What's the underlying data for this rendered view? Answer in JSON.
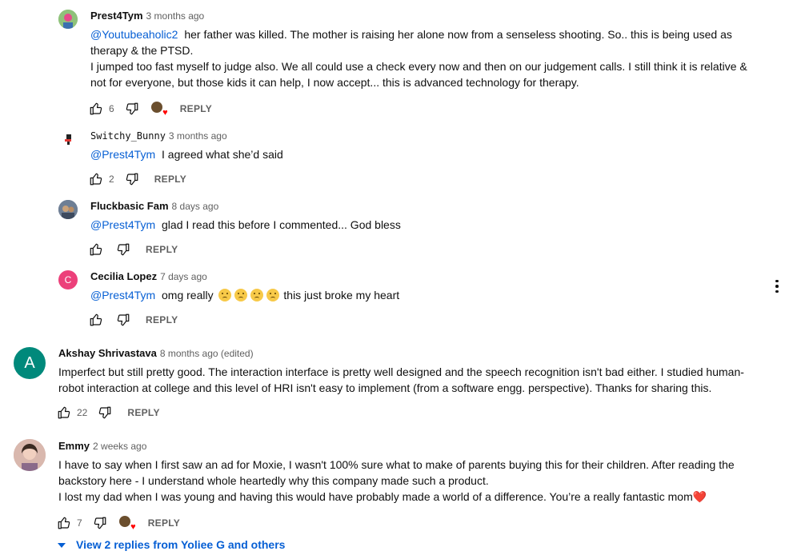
{
  "comments": [
    {
      "author": "Prest4Tym",
      "time": "3 months ago",
      "mention": "@Youtubeaholic2",
      "text_first": "her father was killed. The mother is raising her alone now from a senseless shooting. So.. this is being used as",
      "text_lines": [
        "therapy & the PTSD.",
        "I jumped too fast myself to judge also. We all could use a check every now and then on our judgement calls. I still think it is relative &",
        "not for everyone, but those kids it can help, I now accept... this is advanced technology for therapy."
      ],
      "likes": "6",
      "reply_label": "REPLY",
      "avatar_color": "#7bb36a"
    },
    {
      "author": "Switchy_Bunny",
      "time": "3 months ago",
      "mention": "@Prest4Tym",
      "text": "I agreed what she’d said",
      "likes": "2",
      "reply_label": "REPLY"
    },
    {
      "author": "Fluckbasic Fam",
      "time": "8 days ago",
      "mention": "@Prest4Tym",
      "text": "glad I read this before I commented... God bless",
      "reply_label": "REPLY",
      "avatar_color": "#5a6d8a"
    },
    {
      "author": "Cecilia Lopez",
      "time": "7 days ago",
      "avatar_letter": "C",
      "avatar_color": "#ec407a",
      "mention": "@Prest4Tym",
      "text_before": "omg really",
      "text_after": "this just broke my heart",
      "reply_label": "REPLY"
    },
    {
      "author": "Akshay Shrivastava",
      "time": "8 months ago (edited)",
      "avatar_letter": "A",
      "avatar_color": "#00897b",
      "text_lines": [
        "Imperfect but still pretty good. The interaction interface is pretty well designed and the speech recognition isn't bad either. I studied human-",
        "robot interaction at college and this level of HRI isn't easy to implement (from a software engg. perspective). Thanks for sharing this."
      ],
      "likes": "22",
      "reply_label": "REPLY"
    },
    {
      "author": "Emmy",
      "time": "2 weeks ago",
      "avatar_color": "#c9a7a0",
      "text_lines": [
        "I have to say when I first saw an ad for Moxie, I wasn't 100% sure what to make of parents buying this for their children. After reading the",
        "backstory here - I understand whole heartedly why this company made such a product.",
        "I lost my dad when I was young and having this would have probably made a world of a difference. You’re a really fantastic mom❤️"
      ],
      "likes": "7",
      "reply_label": "REPLY"
    }
  ],
  "view_replies_label": "View 2 replies from Yoliee G and others",
  "colors": {
    "link": "#065fd4",
    "muted": "#606060",
    "heart": "#ff0000"
  }
}
